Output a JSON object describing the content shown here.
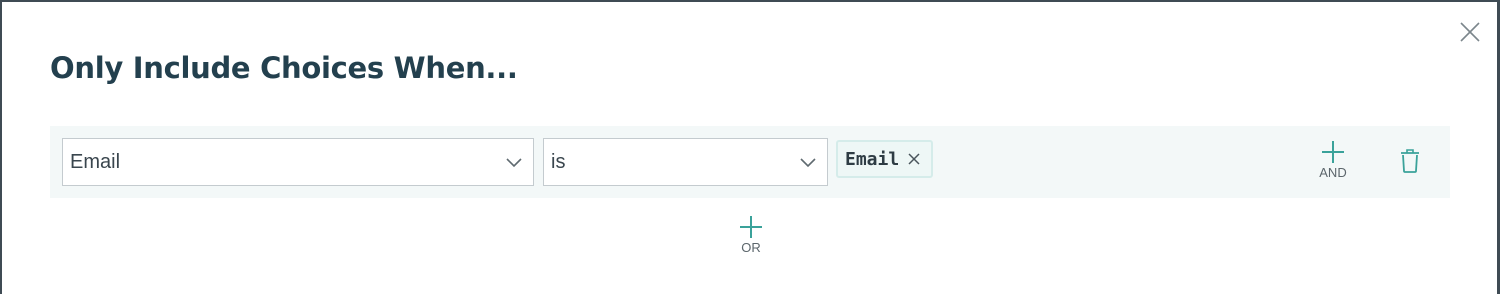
{
  "dialog": {
    "title": "Only Include Choices When..."
  },
  "condition": {
    "field": {
      "value": "Email"
    },
    "operator": {
      "value": "is"
    },
    "values": [
      {
        "label": "Email"
      }
    ],
    "and_label": "AND"
  },
  "or_label": "OR",
  "colors": {
    "accent": "#3aa29a",
    "title": "#23404e",
    "row_background": "#f3f8f8"
  }
}
